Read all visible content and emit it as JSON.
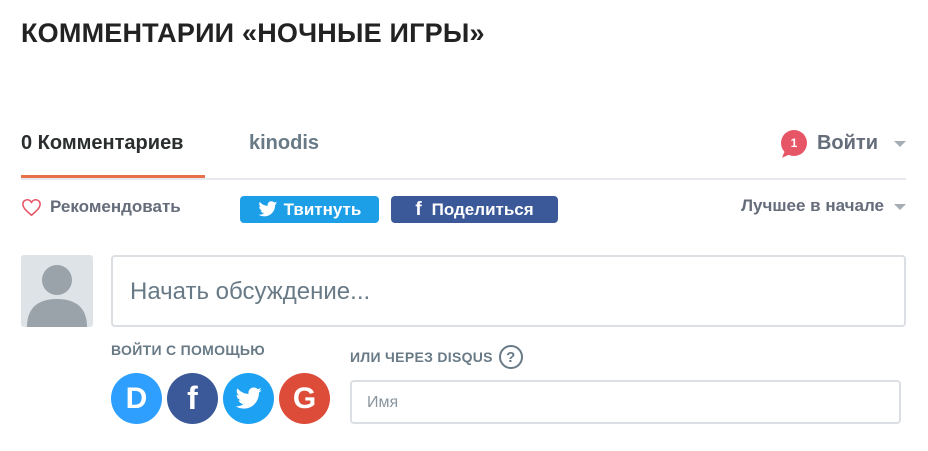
{
  "page": {
    "title": "КОММЕНТАРИИ «НОЧНЫЕ ИГРЫ»"
  },
  "nav": {
    "comments_tab": "0 Комментариев",
    "site_tab": "kinodis",
    "notification_count": "1",
    "login_label": "Войти"
  },
  "actions": {
    "recommend_label": "Рекомендовать",
    "tweet_label": "Твитнуть",
    "share_label": "Поделиться",
    "sort_label": "Лучшее в начале"
  },
  "composer": {
    "placeholder": "Начать обсуждение...",
    "login_with_label": "ВОЙТИ С ПОМОЩЬЮ",
    "social_providers": [
      {
        "name": "Disqus",
        "glyph": "D",
        "color": "#2e9fff"
      },
      {
        "name": "Facebook",
        "glyph": "f",
        "color": "#3b5998"
      },
      {
        "name": "Twitter",
        "glyph": "twitter-bird-icon",
        "color": "#1da1f2"
      },
      {
        "name": "Google",
        "glyph": "G",
        "color": "#dd4b39"
      }
    ],
    "disqus_label": "ИЛИ ЧЕРЕЗ DISQUS",
    "help_glyph": "?",
    "name_placeholder": "Имя"
  },
  "colors": {
    "accent_underline": "#e8704a",
    "badge": "#e65667",
    "twitter": "#1d9fe8",
    "facebook": "#3b5998"
  }
}
